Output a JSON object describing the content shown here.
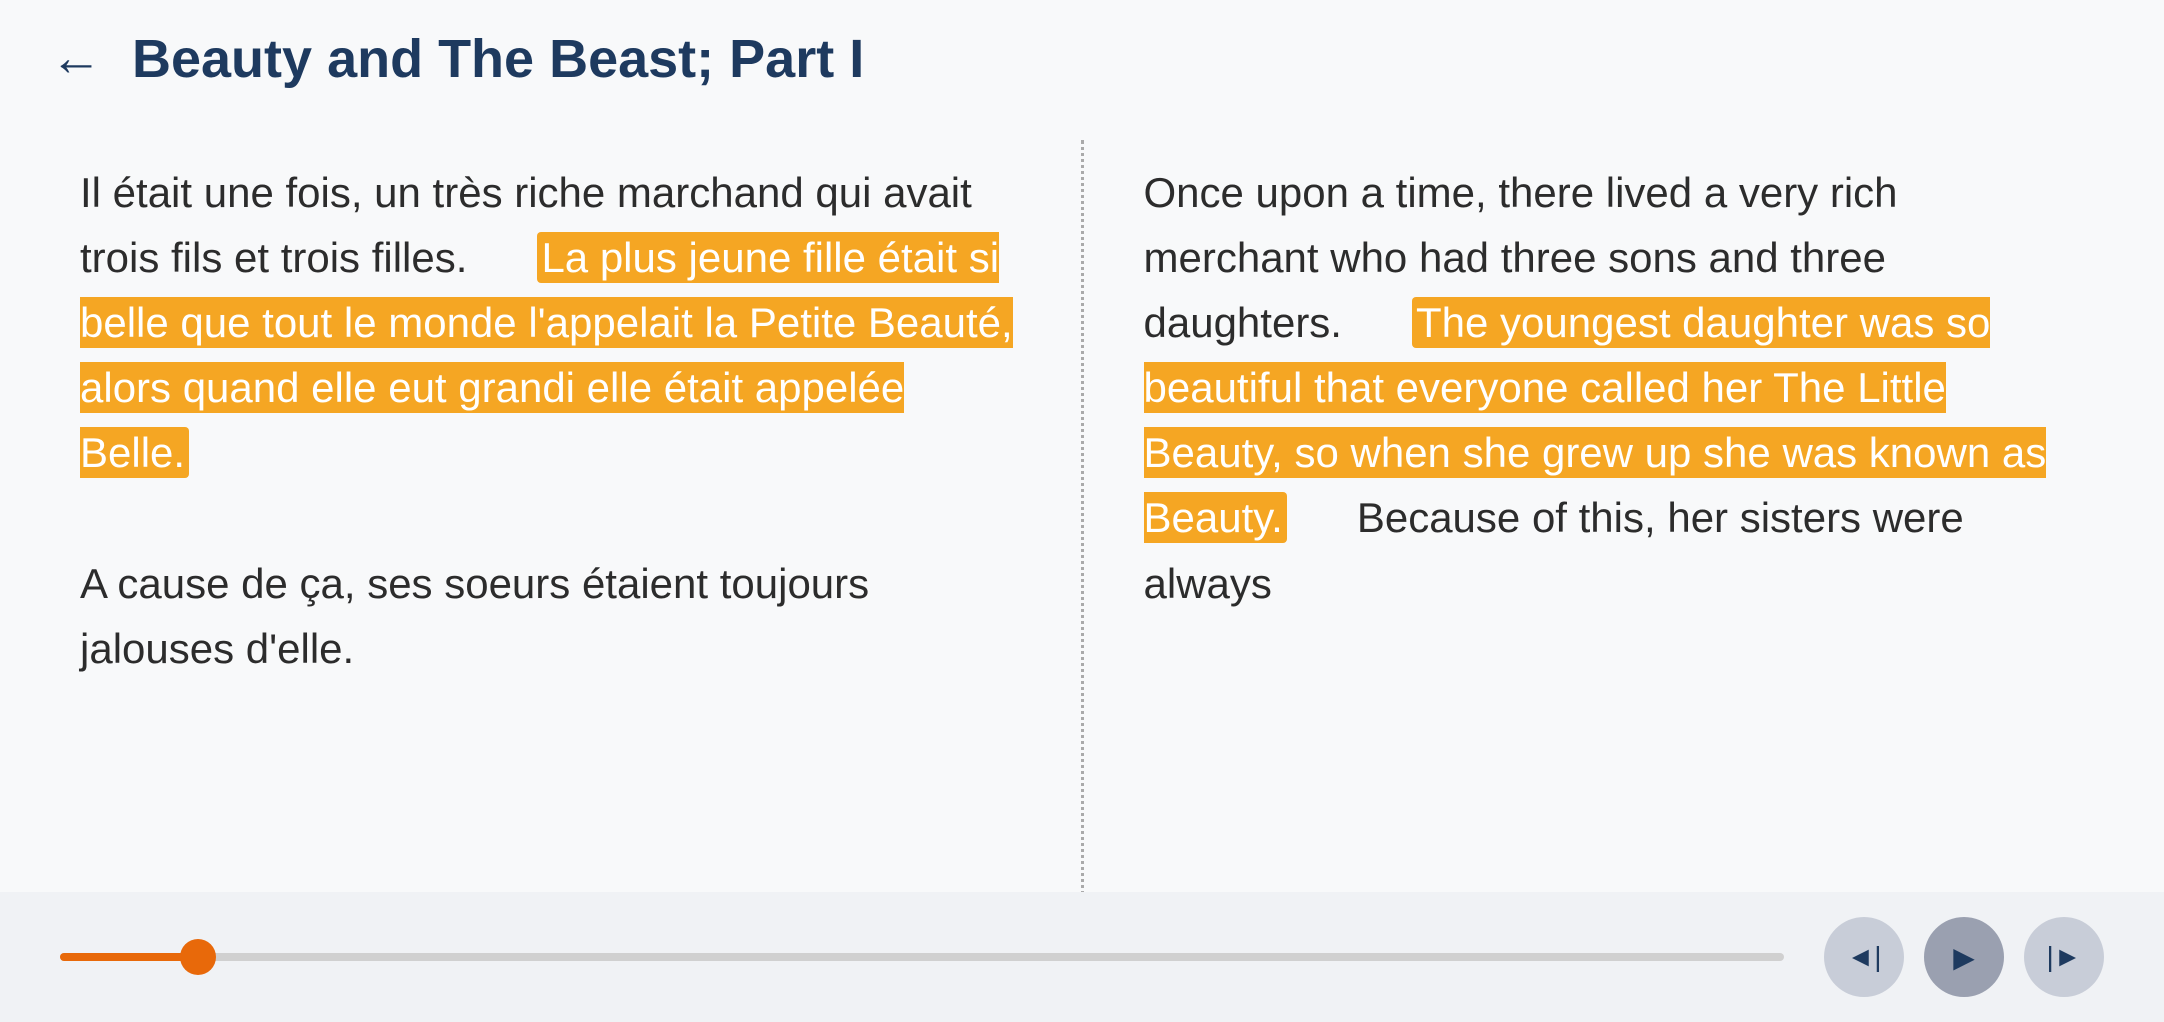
{
  "header": {
    "back_label": "←",
    "title": "Beauty and The Beast; Part I"
  },
  "left_panel": {
    "text_before_highlight": "Il était une fois, un très riche marchand qui avait trois fils et trois filles.",
    "highlighted_text": "La plus jeune fille était si belle que tout le monde l'appelait la Petite Beauté, alors quand elle eut grandi elle était appelée Belle.",
    "text_after_highlight": "A cause de ça, ses soeurs étaient toujours jalouses d'elle."
  },
  "right_panel": {
    "text_before_highlight": "Once upon a time, there lived a very rich merchant who had three sons and three daughters.",
    "highlighted_text": "The youngest daughter was so beautiful that everyone called her The Little Beauty, so when she grew up she was known as Beauty.",
    "text_after_highlight": "Because of this, her sisters were always"
  },
  "controls": {
    "rewind_label": "⏮",
    "play_label": "▶",
    "forward_label": "⏭"
  },
  "progress": {
    "value": 8
  },
  "icons": {
    "back_arrow": "←",
    "rewind": "◄",
    "play": "►",
    "forward": "►|"
  }
}
